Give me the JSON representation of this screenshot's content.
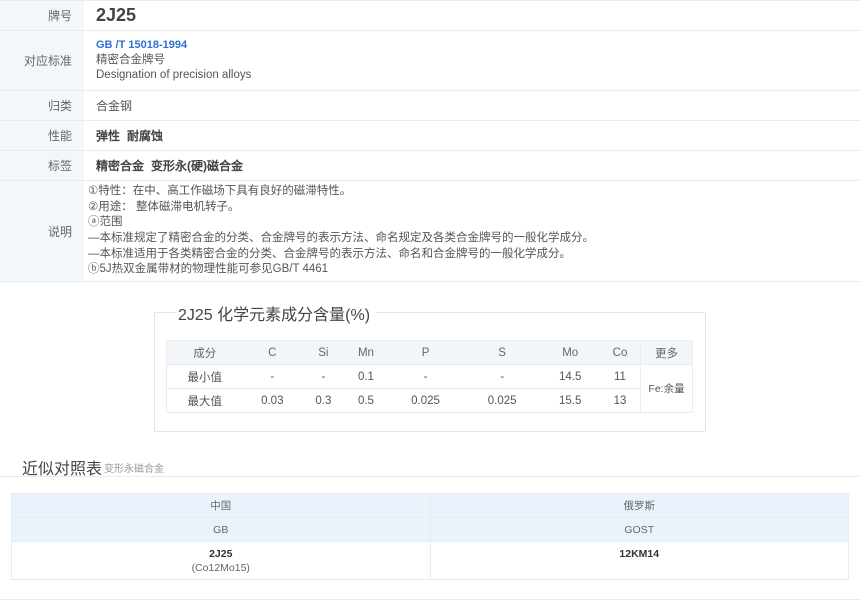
{
  "info": {
    "grade_label": "牌号",
    "grade_value": "2J25",
    "std_label": "对应标准",
    "std_link": "GB /T 15018-1994",
    "std_cn": "精密合金牌号",
    "std_en": "Designation of precision alloys",
    "cat_label": "归类",
    "cat_value": "合金钢",
    "perf_label": "性能",
    "perf_items": [
      "弹性",
      "耐腐蚀"
    ],
    "tag_label": "标签",
    "tag_items": [
      "精密合金",
      "变形永(硬)磁合金"
    ],
    "desc_label": "说明",
    "desc_lines": [
      "①特性：在中、高工作磁场下具有良好的磁滞特性。",
      "②用途：  整体磁滞电机转子。",
      "ⓐ范围",
      "—本标准规定了精密合金的分类、合金牌号的表示方法、命名规定及各类合金牌号的一般化学成分。",
      "—本标准适用于各类精密合金的分类、合金牌号的表示方法、命名和合金牌号的一般化学成分。",
      "ⓑ5J热双金属带材的物理性能可参见GB/T 4461"
    ]
  },
  "composition": {
    "title": "2J25 化学元素成分含量(%)",
    "header": [
      "成分",
      "C",
      "Si",
      "Mn",
      "P",
      "S",
      "Mo",
      "Co",
      "更多"
    ],
    "rows": [
      {
        "label": "最小值",
        "values": [
          "-",
          "-",
          "0.1",
          "-",
          "-",
          "14.5",
          "11"
        ]
      },
      {
        "label": "最大值",
        "values": [
          "0.03",
          "0.3",
          "0.5",
          "0.025",
          "0.025",
          "15.5",
          "13"
        ]
      }
    ],
    "more_value": "Fe:余量"
  },
  "approx": {
    "title": "近似对照表",
    "subtitle": "变形永磁合金",
    "countries": [
      "中国",
      "俄罗斯"
    ],
    "standards": [
      "GB",
      "GOST"
    ],
    "grades": [
      {
        "grade": "2J25",
        "sub": "(Co12Mo15)"
      },
      {
        "grade": "12KM14",
        "sub": ""
      }
    ]
  }
}
